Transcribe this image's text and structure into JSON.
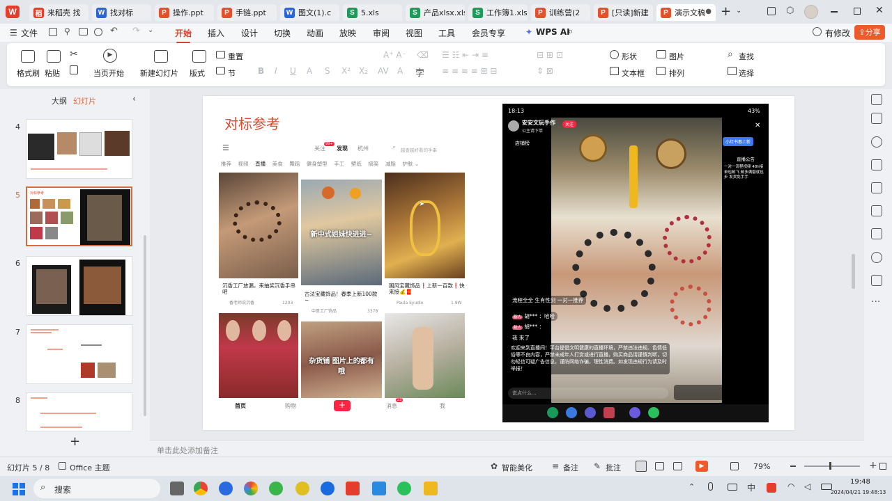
{
  "tabs": [
    {
      "label": "来稻壳 找",
      "icon": "K"
    },
    {
      "label": "找对标",
      "icon": "W"
    },
    {
      "label": "操作.ppt",
      "icon": "P"
    },
    {
      "label": "手链.ppt",
      "icon": "P"
    },
    {
      "label": "图文(1).c",
      "icon": "W"
    },
    {
      "label": "5.xls",
      "icon": "S"
    },
    {
      "label": "产品xlsx.xls",
      "icon": "S"
    },
    {
      "label": "工作簿1.xls",
      "icon": "S"
    },
    {
      "label": "训练营(2",
      "icon": "P"
    },
    {
      "label": "[只读]新建",
      "icon": "P"
    },
    {
      "label": "演示文稿",
      "icon": "P"
    }
  ],
  "menu": {
    "file": "文件",
    "items": [
      "开始",
      "插入",
      "设计",
      "切换",
      "动画",
      "放映",
      "审阅",
      "视图",
      "工具",
      "会员专享"
    ],
    "wps_ai": "WPS AI",
    "edit_label": "有修改",
    "share_label": "分享"
  },
  "ribbon": {
    "format_painter": "格式刷",
    "paste": "粘贴",
    "from_current": "当页开始",
    "new_slide": "新建幻灯片",
    "layout": "版式",
    "reset": "重置",
    "section": "节",
    "shape": "形状",
    "picture": "图片",
    "find": "查找",
    "textbox": "文本框",
    "arrange": "排列",
    "select": "选择"
  },
  "leftpanel": {
    "outline": "大纲",
    "slides": "幻灯片",
    "numbers": [
      "4",
      "5",
      "6",
      "7",
      "8"
    ]
  },
  "slide": {
    "title": "对标参考",
    "app": {
      "follow": "关注",
      "follow_badge": "99+",
      "discover": "发现",
      "city": "杭州",
      "search_placeholder": "越查越好看的手串",
      "categories": [
        "推荐",
        "视频",
        "直播",
        "美食",
        "舞蹈",
        "健身塑型",
        "手工",
        "壁纸",
        "搞笑",
        "减脂",
        "护肤"
      ],
      "cards": [
        {
          "title": "沉香工厂放漏，来抽奖沉香手串吧",
          "author": "香老师说沉香",
          "count": "1203"
        },
        {
          "title": "古法宝藏饰品！春季上新100款~",
          "author": "中意工厂饰品",
          "count": "3378",
          "overlay": "新中式姐妹快进进~"
        },
        {
          "title": "国风宝藏饰品❗上新一百款❗快来接💰🧧",
          "author": "Paula Syudio",
          "count": "1.9W"
        },
        {
          "overlay": "杂货铺 图片上的都有哦"
        }
      ],
      "nav": [
        "首页",
        "购物",
        "消息",
        "我"
      ],
      "msg_badge": "23"
    },
    "live": {
      "time": "18:13",
      "battery": "43%",
      "host": "安安文玩手作",
      "host_sub": "公主请下单",
      "live_tag": "关注",
      "store": "店铺榜",
      "promo": "小红书春上新",
      "notice_title": "直播公告",
      "notice": "一对一流程视频 48h接单包邮飞 邮多满额就包 步 发货免手手",
      "product_tag": "流程全全 生肖性剑 一对一推荐",
      "comments": [
        {
          "badge": "新人",
          "text": "胡*** ：哈哈"
        },
        {
          "badge": "新人",
          "text": "胡*** ："
        },
        {
          "text": "我 来了"
        }
      ],
      "system_msg": "欢迎来到直播间！平台提倡文明健康的直播环境，严禁违法违规、色情低俗等不良内容，严禁未成年人打赏或进行直播，购买商品请谨慎判断，切勿轻信可疑广告信息，谨防网络诈骗，理性消费。如发现违规行为请及时举报！",
      "input_placeholder": "说点什么..."
    }
  },
  "notes_placeholder": "单击此处添加备注",
  "status": {
    "slide_counter": "幻灯片 5 / 8",
    "theme": "Office 主题",
    "smart": "智能美化",
    "notes": "备注",
    "comment": "批注",
    "zoom": "79%"
  },
  "taskbar": {
    "search": "搜索",
    "time": "19:48",
    "date": "2024/04/21 19:48:13"
  }
}
